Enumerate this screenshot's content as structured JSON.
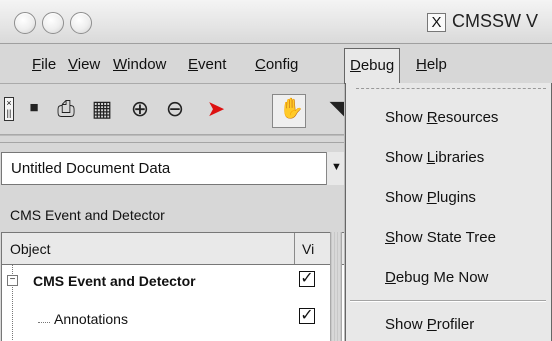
{
  "window": {
    "title": "CMSSW V",
    "title_icon": "x-app-icon"
  },
  "menubar": {
    "items": [
      {
        "prefix": "",
        "mnemonic": "F",
        "suffix": "ile"
      },
      {
        "prefix": "",
        "mnemonic": "V",
        "suffix": "iew"
      },
      {
        "prefix": "",
        "mnemonic": "W",
        "suffix": "indow"
      },
      {
        "prefix": "",
        "mnemonic": "E",
        "suffix": "vent"
      },
      {
        "prefix": "",
        "mnemonic": "C",
        "suffix": "onfig"
      },
      {
        "prefix": "",
        "mnemonic": "D",
        "suffix": "ebug"
      },
      {
        "prefix": "",
        "mnemonic": "H",
        "suffix": "elp"
      }
    ]
  },
  "toolbar": {
    "tools": [
      "save-icon",
      "print-icon",
      "grid-icon",
      "zoom-in-icon",
      "zoom-out-icon",
      "select-arrow-icon",
      "hand-icon",
      "partial-tool-icon"
    ]
  },
  "document": {
    "selector_value": "Untitled Document Data",
    "section_label": "CMS Event and Detector",
    "columns": {
      "object": "Object",
      "visible": "Vi"
    },
    "tree": [
      {
        "label": "CMS Event and Detector",
        "checked": true
      },
      {
        "label": "Annotations",
        "checked": true
      }
    ]
  },
  "debug_menu": {
    "items": [
      {
        "prefix": "Show ",
        "mnemonic": "R",
        "suffix": "esources"
      },
      {
        "prefix": "Show ",
        "mnemonic": "L",
        "suffix": "ibraries"
      },
      {
        "prefix": "Show ",
        "mnemonic": "P",
        "suffix": "lugins"
      },
      {
        "prefix": "",
        "mnemonic": "S",
        "suffix": "how State Tree"
      },
      {
        "prefix": "",
        "mnemonic": "D",
        "suffix": "ebug Me Now"
      },
      {
        "prefix": "Show ",
        "mnemonic": "P",
        "suffix": "rofiler"
      }
    ]
  },
  "colors": {
    "menu_background": "#e8e8e8",
    "toolbar_red_tool": "#d11111"
  }
}
